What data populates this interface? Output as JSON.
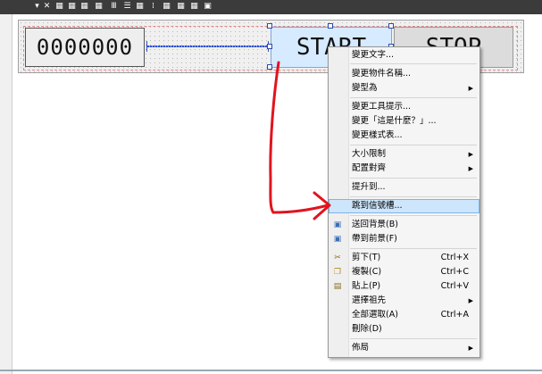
{
  "toolbar": {
    "icons": [
      "dropdown-arrow-icon",
      "close-icon",
      "align-left-icon",
      "align-center-icon",
      "align-right-icon",
      "align-top-icon",
      "distribute-h-icon",
      "distribute-v-icon",
      "grid-icon",
      "grid-dots-icon",
      "snap-icon",
      "tab-order-icon"
    ]
  },
  "form": {
    "lcd_text": "0000000",
    "start_text": "START",
    "stop_text": "STOP"
  },
  "menu": {
    "items": [
      {
        "label": "變更文字..."
      },
      {
        "label": "變更物件名稱..."
      },
      {
        "label": "變型為",
        "submenu": true
      },
      {
        "label": "變更工具提示..."
      },
      {
        "label": "變更「這是什麼？」..."
      },
      {
        "label": "變更樣式表..."
      },
      {
        "label": "大小限制",
        "submenu": true
      },
      {
        "label": "配置對齊",
        "submenu": true
      },
      {
        "label": "提升到..."
      },
      {
        "label": "跳到信號槽...",
        "highlighted": true
      },
      {
        "label": "送回背景(B)",
        "icon": "send-to-back-icon"
      },
      {
        "label": "帶到前景(F)",
        "icon": "bring-to-front-icon"
      },
      {
        "label": "剪下(T)",
        "shortcut": "Ctrl+X",
        "icon": "cut-icon"
      },
      {
        "label": "複製(C)",
        "shortcut": "Ctrl+C",
        "icon": "copy-icon"
      },
      {
        "label": "貼上(P)",
        "shortcut": "Ctrl+V",
        "icon": "paste-icon"
      },
      {
        "label": "選擇祖先",
        "submenu": true
      },
      {
        "label": "全部選取(A)",
        "shortcut": "Ctrl+A"
      },
      {
        "label": "刪除(D)"
      },
      {
        "label": "佈局",
        "submenu": true
      }
    ]
  },
  "colors": {
    "annotation_arrow": "#e0141e",
    "highlight": "#cde6fb",
    "selection_handle": "#2a4ab0"
  }
}
